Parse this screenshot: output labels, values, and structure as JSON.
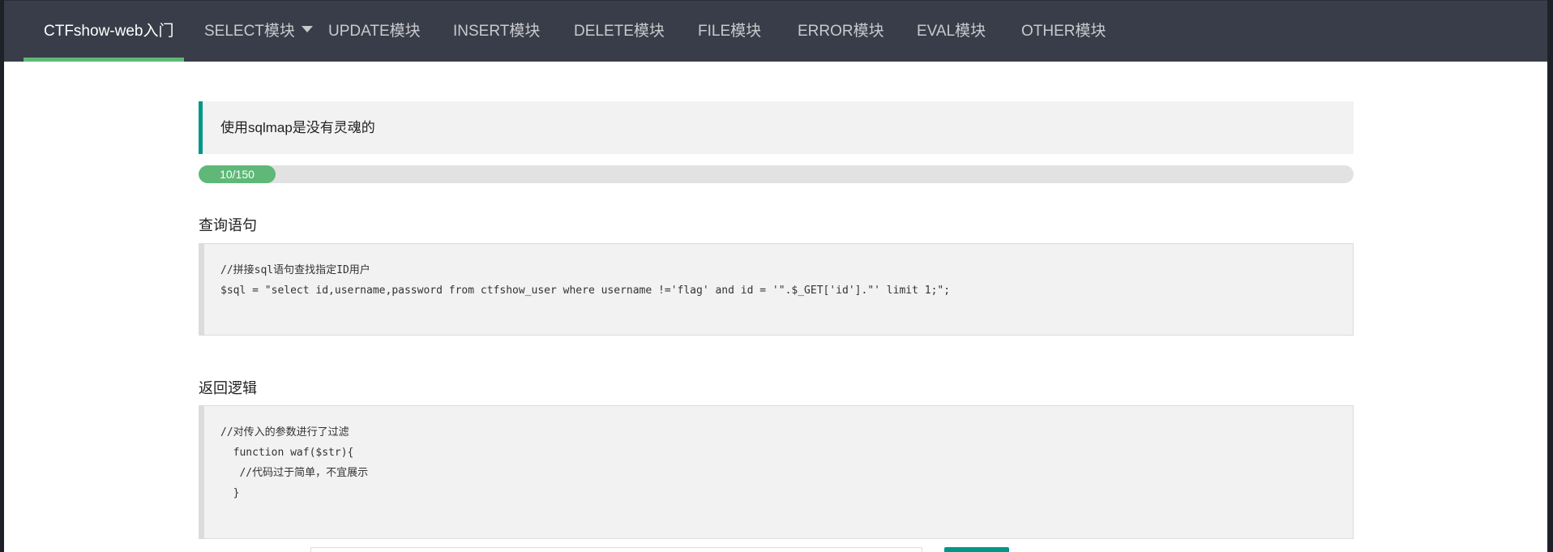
{
  "nav": {
    "items": [
      {
        "label": "CTFshow-web入门",
        "active": true
      },
      {
        "label": "SELECT模块",
        "dropdown": true
      },
      {
        "label": "UPDATE模块"
      },
      {
        "label": "INSERT模块"
      },
      {
        "label": "DELETE模块"
      },
      {
        "label": "FILE模块"
      },
      {
        "label": "ERROR模块"
      },
      {
        "label": "EVAL模块"
      },
      {
        "label": "OTHER模块"
      }
    ],
    "accent_color": "#5fb878",
    "background_color": "#393d49"
  },
  "tip": {
    "text": "使用sqlmap是没有灵魂的",
    "border_color": "#009688"
  },
  "progress": {
    "label": "10/150",
    "value": 10,
    "max": 150,
    "color": "#5fb878"
  },
  "query_section": {
    "title": "查询语句",
    "lines": [
      "//拼接sql语句查找指定ID用户",
      "$sql = \"select id,username,password from ctfshow_user where username !='flag' and id = '\".$_GET['id'].\"' limit 1;\";"
    ]
  },
  "return_section": {
    "title": "返回逻辑",
    "lines": [
      "//对传入的参数进行了过滤",
      "  function waf($str){",
      "   //代码过于简单，不宜展示",
      "  }"
    ]
  }
}
